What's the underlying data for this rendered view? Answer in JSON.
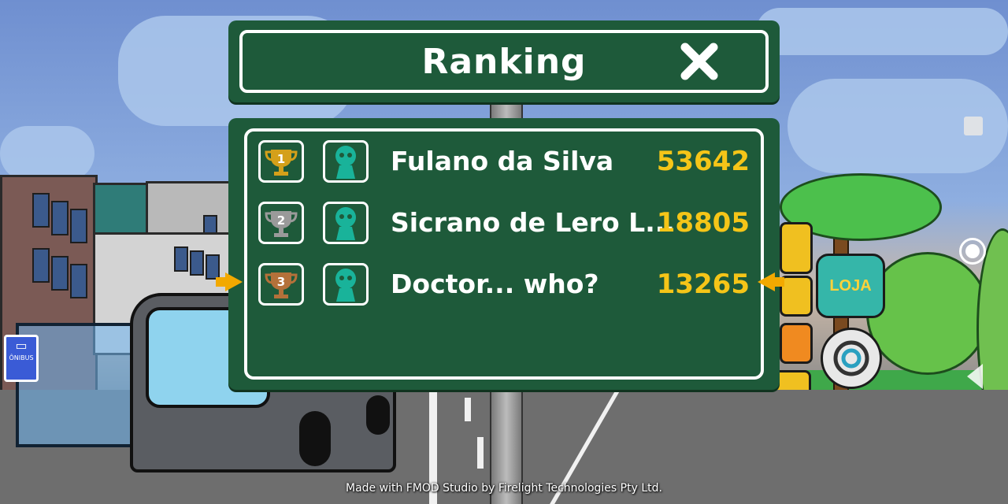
{
  "header": {
    "title": "Ranking",
    "close_icon": "close-x-icon"
  },
  "ranking": [
    {
      "position": "1",
      "medal": "gold",
      "medal_color": "#d4a01a",
      "name": "Fulano da Silva",
      "score": "53642"
    },
    {
      "position": "2",
      "medal": "silver",
      "medal_color": "#9a9a9a",
      "name": "Sicrano de Lero L...",
      "score": "18805"
    },
    {
      "position": "3",
      "medal": "bronze",
      "medal_color": "#b4713a",
      "name": "Doctor... who?",
      "score": "13265"
    }
  ],
  "highlighted_row": 3,
  "colors": {
    "board": "#1e5a3a",
    "score": "#f5c518",
    "marker": "#f2a900",
    "avatar": "#19b39a"
  },
  "background": {
    "stop_sign": "ÔNIBUS",
    "shop_sign": "LOJA"
  },
  "footer": {
    "credit": "Made with FMOD Studio by Firelight Technologies Pty Ltd."
  }
}
